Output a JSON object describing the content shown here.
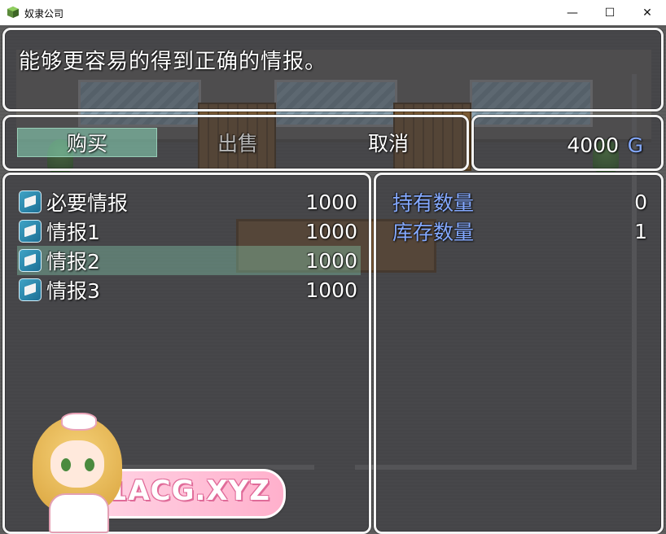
{
  "window": {
    "title": "奴隶公司",
    "minimize_glyph": "—",
    "maximize_glyph": "☐",
    "close_glyph": "✕"
  },
  "help": {
    "text": "能够更容易的得到正确的情报。"
  },
  "commands": {
    "buy": "购买",
    "sell": "出售",
    "cancel": "取消",
    "selected": "buy"
  },
  "gold": {
    "value": "4000",
    "unit": "G"
  },
  "items": [
    {
      "name": "必要情报",
      "price": "1000",
      "icon": "book-icon"
    },
    {
      "name": "情报1",
      "price": "1000",
      "icon": "book-icon"
    },
    {
      "name": "情报2",
      "price": "1000",
      "icon": "book-icon"
    },
    {
      "name": "情报3",
      "price": "1000",
      "icon": "book-icon"
    }
  ],
  "selected_item_index": 2,
  "status": {
    "owned_label": "持有数量",
    "owned_value": "0",
    "stock_label": "库存数量",
    "stock_value": "1"
  },
  "watermark": {
    "text": "91ACG.XYZ"
  },
  "colors": {
    "system_blue": "#84a9ff",
    "selection": "#8cdcbe",
    "window_border": "#f4f4f4"
  }
}
